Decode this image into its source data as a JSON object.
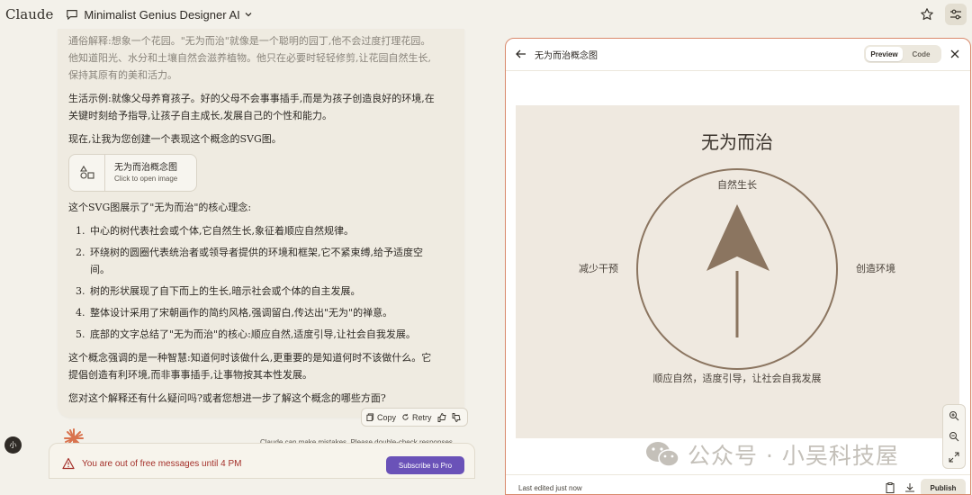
{
  "app": {
    "brand": "Claude",
    "project_name": "Minimalist Genius Designer AI"
  },
  "message": {
    "p1": "通俗解释:想象一个花园。\"无为而治\"就像是一个聪明的园丁,他不会过度打理花园。他知道阳光、水分和土壤自然会滋养植物。他只在必要时轻轻修剪,让花园自然生长,保持其原有的美和活力。",
    "p2": "生活示例:就像父母养育孩子。好的父母不会事事插手,而是为孩子创造良好的环境,在关键时刻给予指导,让孩子自主成长,发展自己的个性和能力。",
    "p3": "现在,让我为您创建一个表现这个概念的SVG图。",
    "artifact_title": "无为而治概念图",
    "artifact_sub": "Click to open image",
    "p4": "这个SVG图展示了\"无为而治\"的核心理念:",
    "list": [
      "中心的树代表社会或个体,它自然生长,象征着顺应自然规律。",
      "环绕树的圆圈代表统治者或领导者提供的环境和框架,它不紧束缚,给予适度空间。",
      "树的形状展现了自下而上的生长,暗示社会或个体的自主发展。",
      "整体设计采用了宋朝画作的简约风格,强调留白,传达出\"无为\"的禅意。",
      "底部的文字总结了\"无为而治\"的核心:顺应自然,适度引导,让社会自我发展。"
    ],
    "p5": "这个概念强调的是一种智慧:知道何时该做什么,更重要的是知道何时不该做什么。它提倡创造有利环境,而非事事插手,让事物按其本性发展。",
    "p6": "您对这个解释还有什么疑问吗?或者您想进一步了解这个概念的哪些方面?"
  },
  "actions": {
    "copy": "Copy",
    "retry": "Retry"
  },
  "disclaimer": "Claude can make mistakes. Please double-check responses.",
  "avatar_initial": "小",
  "warning": {
    "text": "You are out of free messages until 4 PM",
    "button": "Subscribe to Pro"
  },
  "panel": {
    "title": "无为而治概念图",
    "tab_preview": "Preview",
    "tab_code": "Code",
    "footer_edited": "Last edited just now",
    "publish": "Publish"
  },
  "svg_art": {
    "title": "无为而治",
    "top_label": "自然生长",
    "left_label": "减少干预",
    "right_label": "创造环境",
    "bottom_label": "顺应自然，适度引导，让社会自我发展",
    "bg_color": "#efe9e0",
    "accent_color": "#8b7560"
  },
  "watermark": {
    "text": "公众号 · 小吴科技屋",
    "icon": "wechat-icon"
  }
}
